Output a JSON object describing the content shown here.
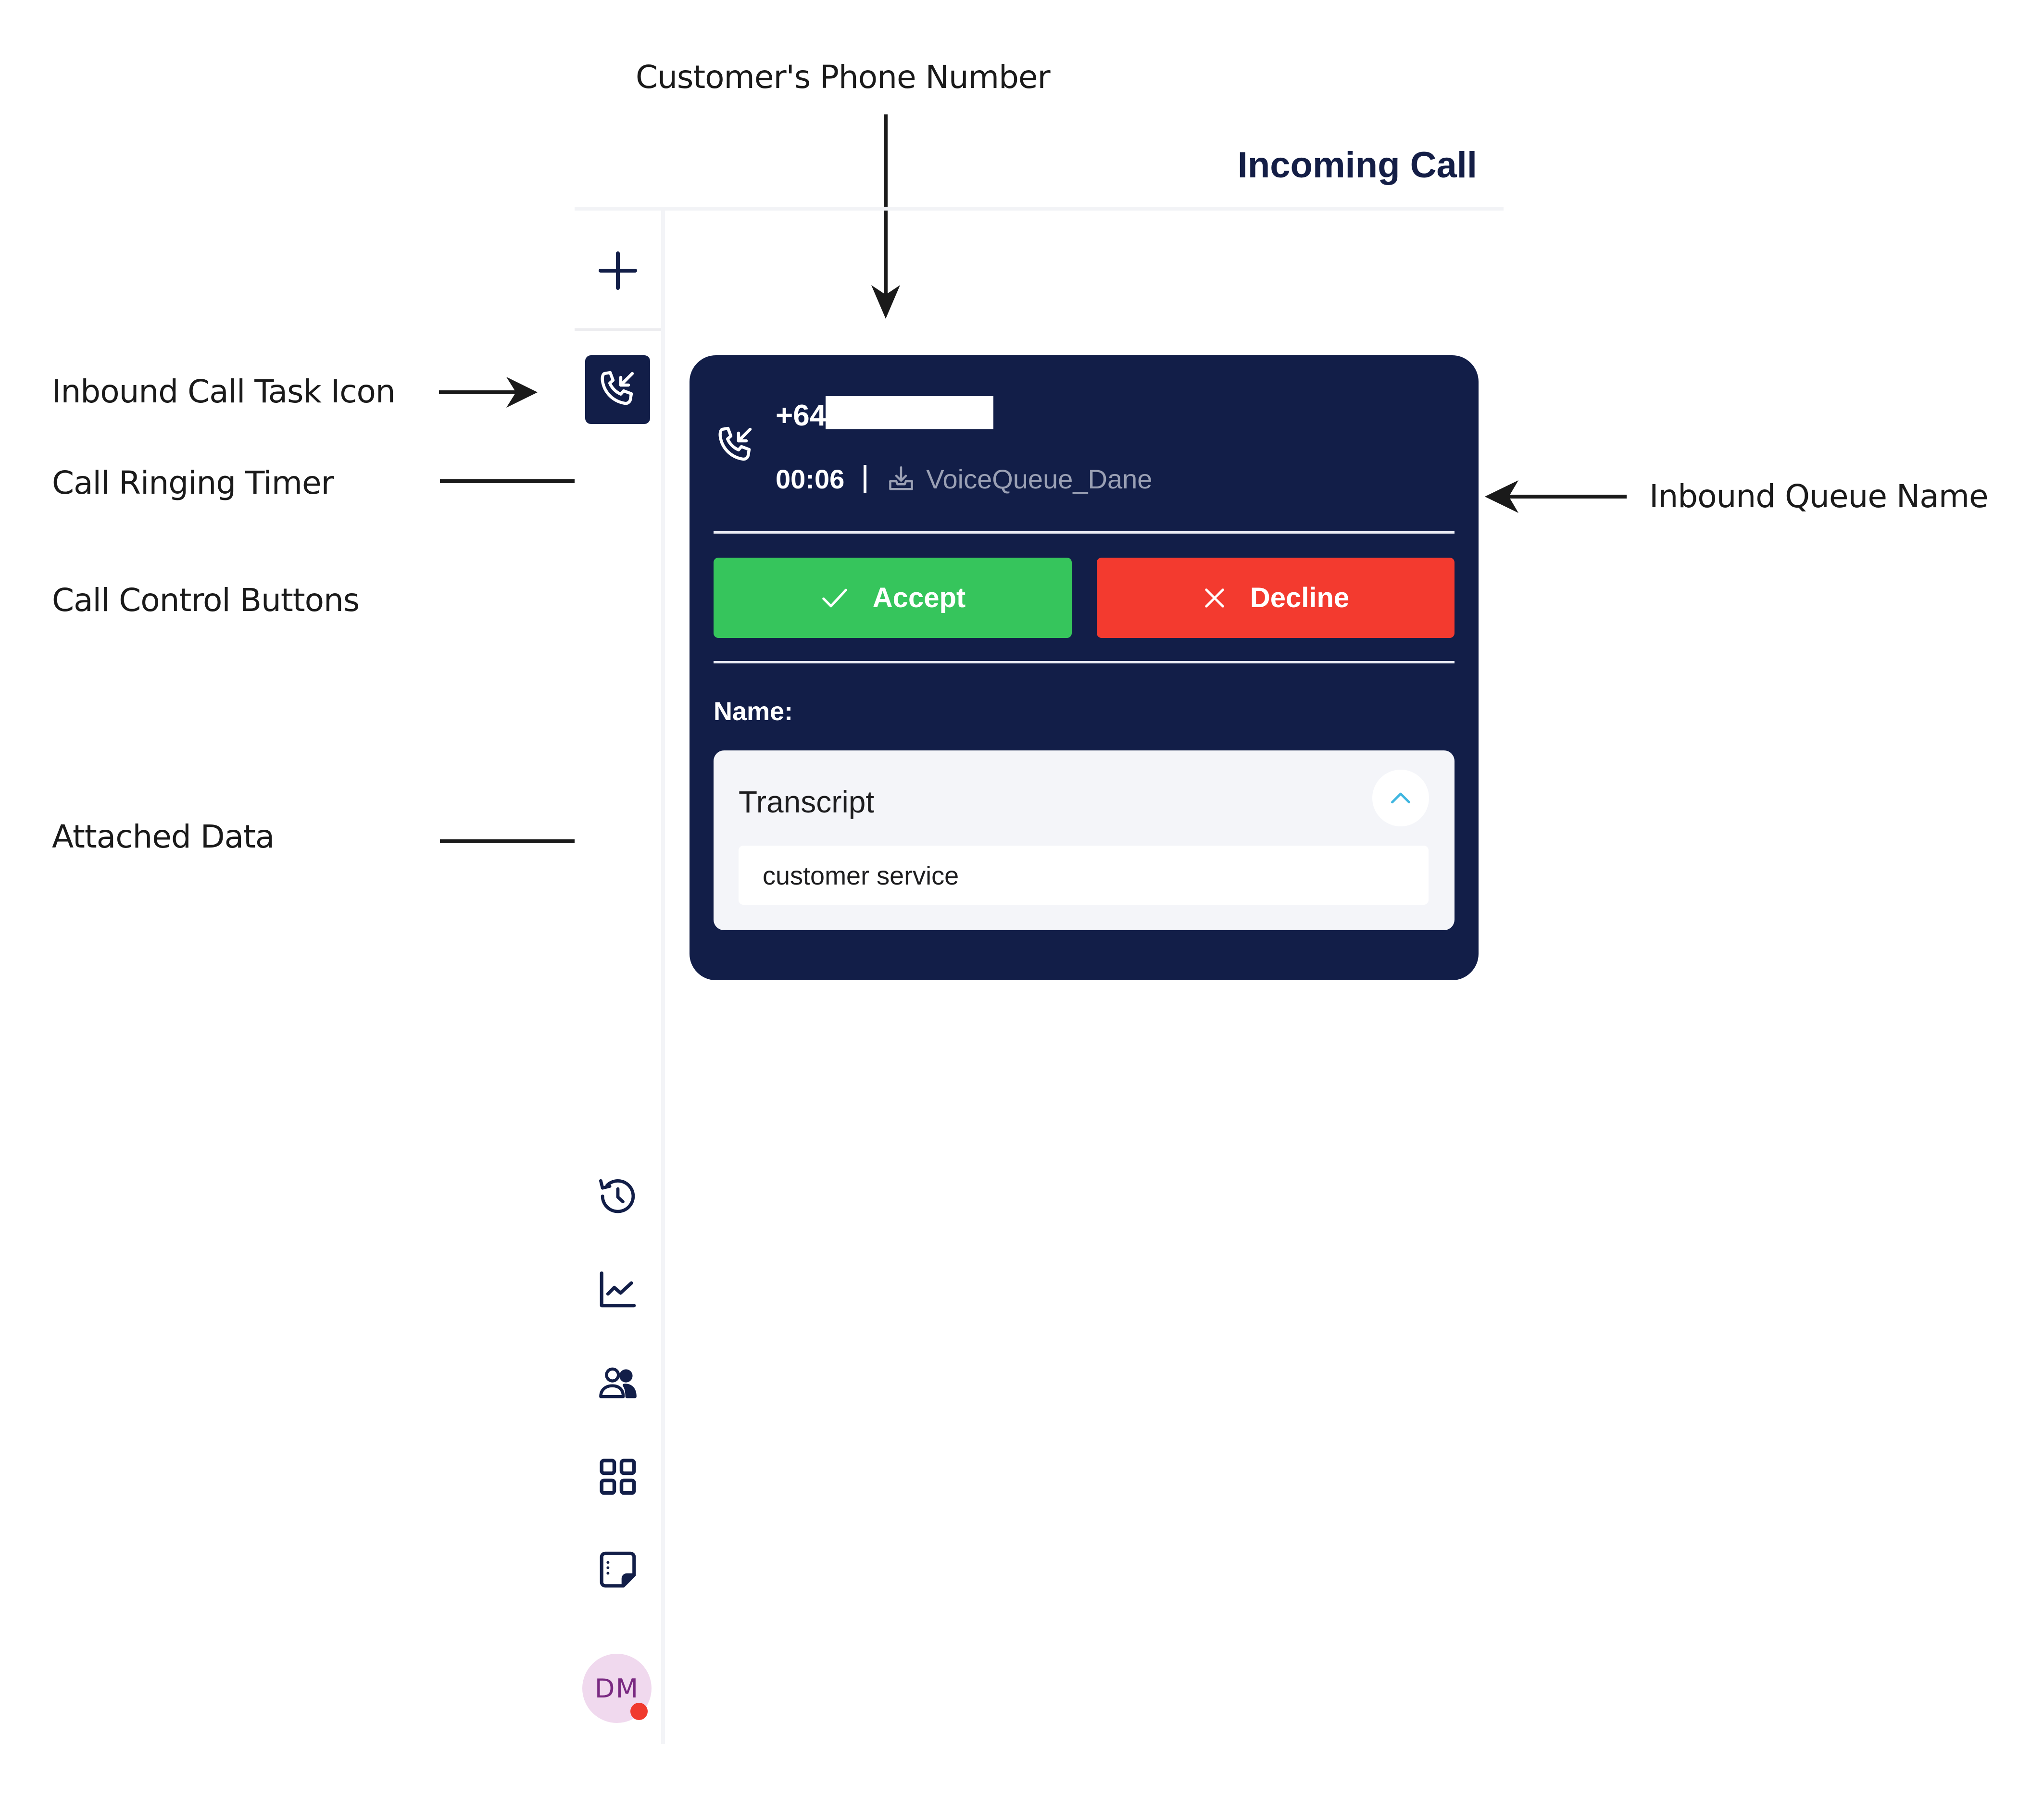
{
  "annotations": {
    "phone_number": "Customer's Phone Number",
    "task_icon": "Inbound Call Task Icon",
    "ringing_timer": "Call Ringing Timer",
    "control_buttons": "Call Control Buttons",
    "attached_data": "Attached Data",
    "queue_name": "Inbound Queue Name"
  },
  "header": {
    "title": "Incoming Call"
  },
  "sidebar": {
    "items": [
      {
        "icon": "plus-icon",
        "label": "New"
      },
      {
        "icon": "inbound-call-icon",
        "label": "Inbound Call Task",
        "active": true
      },
      {
        "icon": "history-icon",
        "label": "History"
      },
      {
        "icon": "chart-icon",
        "label": "Analytics"
      },
      {
        "icon": "users-icon",
        "label": "Contacts"
      },
      {
        "icon": "apps-grid-icon",
        "label": "Apps"
      },
      {
        "icon": "notes-icon",
        "label": "Notes"
      }
    ],
    "avatar": {
      "initials": "DM",
      "status_color": "#f03a2e"
    }
  },
  "call_card": {
    "phone_prefix": "+64",
    "phone_redacted": true,
    "timer": "00:06",
    "queue_name": "VoiceQueue_Dane",
    "accept_label": "Accept",
    "decline_label": "Decline",
    "name_label": "Name:",
    "attached_data": {
      "title": "Transcript",
      "expanded": true,
      "value": "customer service"
    }
  },
  "colors": {
    "card_bg": "#121e48",
    "accept": "#36c55c",
    "decline": "#f33a2f",
    "chevron": "#3fb6e0"
  }
}
